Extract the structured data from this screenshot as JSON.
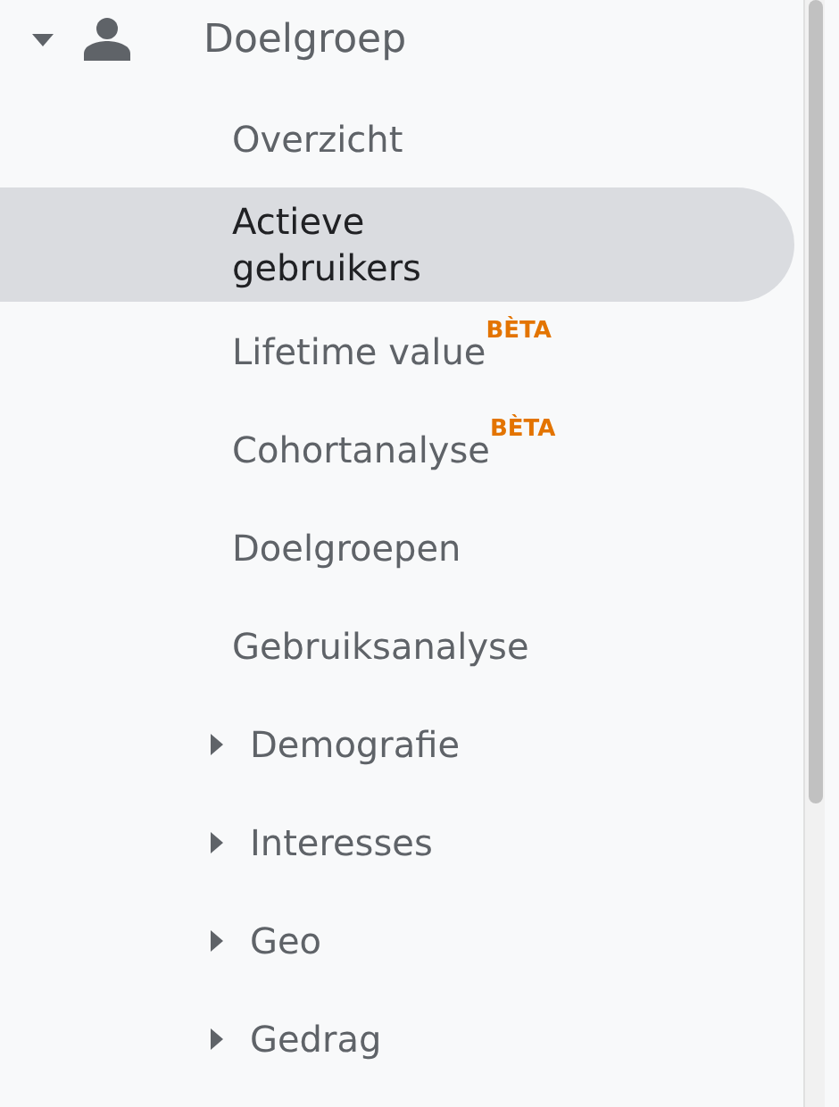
{
  "section": {
    "label": "Doelgroep",
    "expanded": true,
    "children": [
      {
        "kind": "link",
        "label": "Overzicht",
        "selected": false
      },
      {
        "kind": "link",
        "label": "Actieve gebruikers",
        "selected": true
      },
      {
        "kind": "link",
        "label": "Lifetime value",
        "badge": "BÈTA",
        "selected": false
      },
      {
        "kind": "link",
        "label": "Cohortanalyse",
        "badge": "BÈTA",
        "selected": false
      },
      {
        "kind": "link",
        "label": "Doelgroepen",
        "selected": false
      },
      {
        "kind": "link",
        "label": "Gebruiksanalyse",
        "selected": false
      },
      {
        "kind": "group",
        "label": "Demografie",
        "expanded": false,
        "selected": false
      },
      {
        "kind": "group",
        "label": "Interesses",
        "expanded": false,
        "selected": false
      },
      {
        "kind": "group",
        "label": "Geo",
        "expanded": false,
        "selected": false
      },
      {
        "kind": "group",
        "label": "Gedrag",
        "expanded": false,
        "selected": false
      }
    ]
  }
}
